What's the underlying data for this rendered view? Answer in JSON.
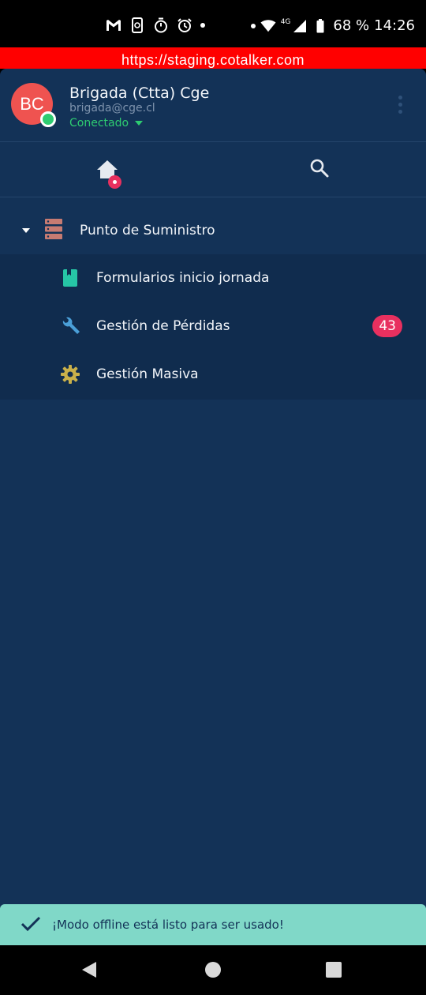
{
  "status_bar": {
    "icons_left": [
      "gmail-icon",
      "sync-icon",
      "timer-icon",
      "alarm-icon",
      "dot"
    ],
    "network": "4G",
    "battery": "68 %",
    "time": "14:26"
  },
  "browser": {
    "url": "https://staging.cotalker.com"
  },
  "profile": {
    "initials": "BC",
    "name": "Brigada (Ctta) Cge",
    "email": "brigada@cge.cl",
    "status": "Conectado",
    "avatar_color": "#ef5350",
    "presence_color": "#2ecc71"
  },
  "nav": {
    "home_icon": "home-icon",
    "search_icon": "search-icon"
  },
  "menu": {
    "group": {
      "label": "Punto de Suministro",
      "icon": "server-icon"
    },
    "items": [
      {
        "label": "Formularios inicio jornada",
        "icon": "book-icon",
        "icon_color": "#26c6a6"
      },
      {
        "label": "Gestión de Pérdidas",
        "icon": "wrench-icon",
        "icon_color": "#4a9fd8",
        "badge": "43"
      },
      {
        "label": "Gestión Masiva",
        "icon": "gear-icon",
        "icon_color": "#c9b04a"
      }
    ]
  },
  "snackbar": {
    "message": "¡Modo offline está listo para ser usado!",
    "icon": "check-icon"
  },
  "colors": {
    "background": "#133257",
    "badge": "#e8305f",
    "snackbar": "#80d8c8",
    "url_bar": "#ff0000"
  }
}
